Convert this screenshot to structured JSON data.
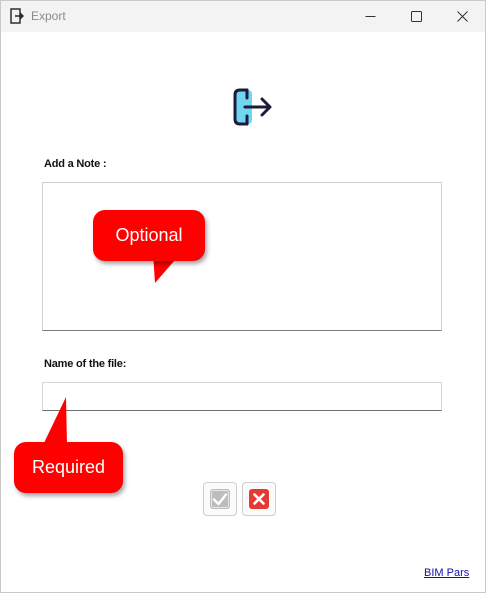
{
  "window": {
    "title": "Export",
    "icons": {
      "app": "export-door-icon",
      "minimize": "minimize-icon",
      "maximize": "maximize-icon",
      "close": "close-icon"
    }
  },
  "header": {
    "icon": "export-arrow-icon",
    "icon_colors": {
      "outline": "#1d1b3a",
      "fill": "#6fd6f2"
    }
  },
  "note": {
    "label": "Add a Note :",
    "value": "",
    "callout": "Optional"
  },
  "file": {
    "label": "Name of the file:",
    "value": "",
    "placeholder": "",
    "callout": "Required"
  },
  "actions": {
    "ok_icon": "checkmark-icon",
    "ok_enabled": false,
    "cancel_icon": "x-icon"
  },
  "footer": {
    "link": "BIM Pars"
  },
  "colors": {
    "callout": "#ff0000",
    "cancel_red": "#e53935",
    "link": "#1a0dab",
    "titlebar": "#f3f3f3"
  }
}
